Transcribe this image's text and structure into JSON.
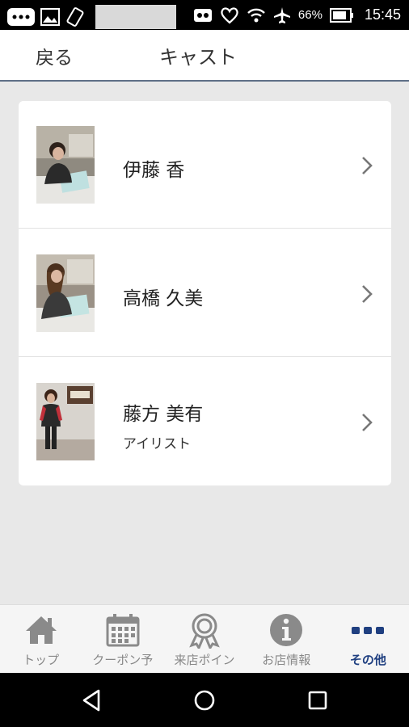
{
  "status_bar": {
    "battery": "66%",
    "time": "15:45"
  },
  "header": {
    "back_label": "戻る",
    "title": "キャスト"
  },
  "cast": [
    {
      "name": "伊藤 香",
      "role": ""
    },
    {
      "name": "高橋 久美",
      "role": ""
    },
    {
      "name": "藤方 美有",
      "role": "アイリスト"
    }
  ],
  "tabs": [
    {
      "label": "トップ",
      "icon": "home-icon"
    },
    {
      "label": "クーポン予",
      "icon": "calendar-icon"
    },
    {
      "label": "来店ポイン",
      "icon": "award-icon"
    },
    {
      "label": "お店情報",
      "icon": "info-icon"
    },
    {
      "label": "その他",
      "icon": "more-icon",
      "active": true
    }
  ],
  "colors": {
    "accent": "#1f3f80",
    "tab_inactive": "#888888",
    "header_rule": "#5e6f87"
  }
}
